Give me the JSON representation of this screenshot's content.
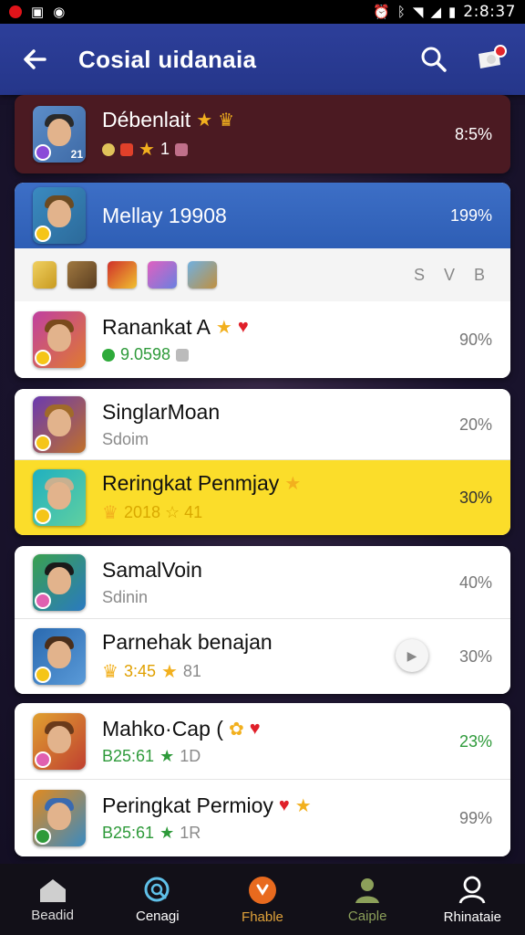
{
  "status": {
    "time": "2:8:37",
    "left_icons": [
      "record-icon",
      "image-icon",
      "camera-icon"
    ],
    "right_icons": [
      "alarm-icon",
      "bluetooth-icon",
      "wifi-icon",
      "signal-icon",
      "battery-icon"
    ]
  },
  "header": {
    "title": "Cosial uidanaia",
    "back_icon": "arrow-left-icon",
    "search_icon": "search-icon",
    "profile_icon": "profile-bell-icon",
    "colors": {
      "bar": "#2d3f9a"
    }
  },
  "rows": [
    {
      "name": "Débenlait",
      "sub": "1",
      "pct": "8:5%",
      "style": "top",
      "avatar_num": "21"
    },
    {
      "name": "Mellay 19908",
      "sub": "",
      "pct": "199%",
      "style": "blue"
    },
    {
      "chips_right": "S V B",
      "style": "chips"
    },
    {
      "name": "Ranankat A",
      "sub": "9.0598",
      "pct": "90%",
      "style": "white"
    },
    {
      "name": "SinglarMoan",
      "sub": "Sdoim",
      "pct": "20%",
      "style": "white"
    },
    {
      "name": "Reringkat Penmjay",
      "sub": "2018 ☆ 41",
      "pct": "30%",
      "style": "yellow"
    },
    {
      "name": "SamalVoin",
      "sub": "Sdinin",
      "pct": "40%",
      "style": "white"
    },
    {
      "name": "Parnehak benajan",
      "sub": "3:45",
      "sub2": "81",
      "pct": "30%",
      "style": "white"
    },
    {
      "name": "Mahko·Cap (",
      "sub": "B25:61",
      "sub2": "1D",
      "pct": "23%",
      "style": "white",
      "pct_color": "#2e9a3a"
    },
    {
      "name": "Peringkat Permioy",
      "sub": "B25:61",
      "sub2": "1R",
      "pct": "99%",
      "style": "white"
    }
  ],
  "nav": [
    {
      "label": "Beadid",
      "icon": "home-icon",
      "color": "#dddddd"
    },
    {
      "label": "Cenagi",
      "icon": "search-circle-icon",
      "color": "#ffffff"
    },
    {
      "label": "Fhable",
      "icon": "fire-icon",
      "color": "#e0a23a"
    },
    {
      "label": "Caiple",
      "icon": "person-icon",
      "color": "#8ca05a"
    },
    {
      "label": "Rhinataie",
      "icon": "profile-icon",
      "color": "#ffffff"
    }
  ]
}
